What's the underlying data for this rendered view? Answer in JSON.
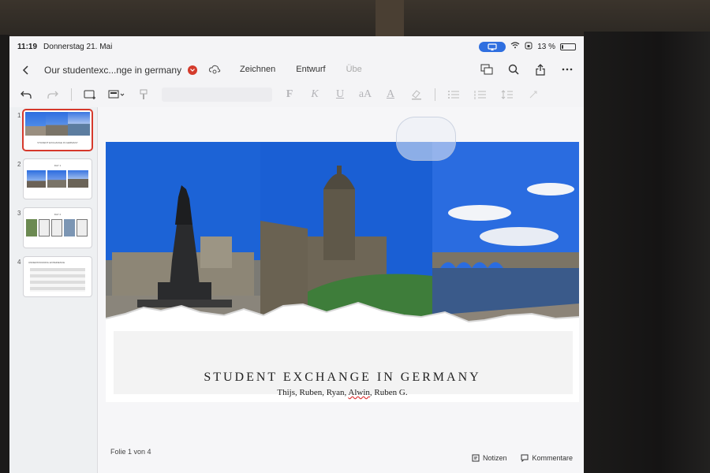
{
  "status": {
    "time": "11:19",
    "date": "Donnerstag 21. Mai",
    "battery": "13 %",
    "battery_level": 0.13
  },
  "titlebar": {
    "doc_title": "Our studentexc...nge in germany",
    "tabs": [
      {
        "label": "Zeichnen"
      },
      {
        "label": "Entwurf"
      },
      {
        "label": "Übe"
      }
    ]
  },
  "toolbar": {
    "bold": "F",
    "italic": "K",
    "underline": "U",
    "text_size": "aA",
    "font_color": "A"
  },
  "thumbnails": [
    {
      "number": "1",
      "caption": "STUDENT EXCHANGE IN GERMANY"
    },
    {
      "number": "2",
      "caption": "DAY 1"
    },
    {
      "number": "3",
      "caption": "DAY 2"
    },
    {
      "number": "4",
      "caption": "UNDERSTANDING EXPERIENCE"
    }
  ],
  "slide": {
    "title": "STUDENT EXCHANGE IN GERMANY",
    "subtitle_before": "Thijs, Ruben, Ryan, ",
    "subtitle_flagged": "Alwin",
    "subtitle_after": ", Ruben G."
  },
  "footer": {
    "slide_counter": "Folie 1 von 4",
    "notes_label": "Notizen",
    "comments_label": "Kommentare"
  },
  "colors": {
    "accent_red": "#d6392c",
    "sky_blue": "#1e64d8",
    "airplay_blue": "#2f6fe0"
  }
}
